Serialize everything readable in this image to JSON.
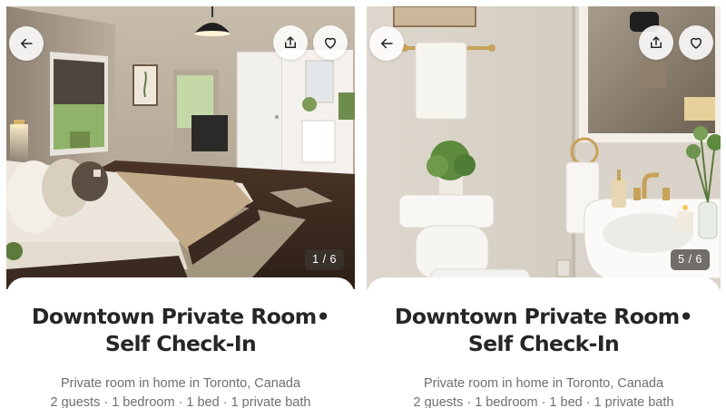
{
  "listings": [
    {
      "title_line1": "Downtown Private Room•",
      "title_line2": "Self Check-In",
      "subtitle": "Private room in home in Toronto, Canada",
      "details": "2 guests · 1 bedroom · 1 bed · 1 private bath",
      "photo_counter": "1 / 6",
      "photo_subject": "bedroom"
    },
    {
      "title_line1": "Downtown Private Room•",
      "title_line2": "Self Check-In",
      "subtitle": "Private room in home in Toronto, Canada",
      "details": "2 guests · 1 bedroom · 1 bed · 1 private bath",
      "photo_counter": "5 / 6",
      "photo_subject": "bathroom"
    }
  ],
  "icons": {
    "back": "arrow-left-icon",
    "share": "share-icon",
    "favorite": "heart-icon"
  },
  "colors": {
    "title": "#262626",
    "secondary_text": "#6f6f6f",
    "overlay_button": "#ffffff",
    "counter_badge": "#3c3732"
  }
}
